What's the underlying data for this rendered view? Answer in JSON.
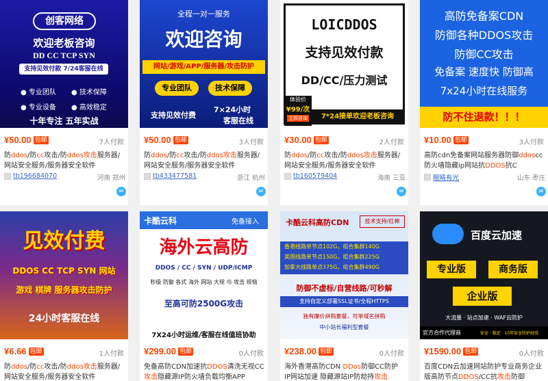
{
  "products": [
    {
      "price": "¥50.00",
      "badge": "包邮",
      "sales": "7人付款",
      "title_parts": [
        "防",
        "ddos",
        "/防",
        "cc",
        "攻击/防",
        "ddos攻击",
        "服务器/网站安全服务/服务器安全软件"
      ],
      "shop": "tb196684070",
      "location": "河南 郑州",
      "thumb": {
        "brand": "创客网络",
        "line1": "欢迎老板咨询",
        "line2": "DD  CC  TCP  SYN",
        "line3": "支持见效付款 7/24客服在线",
        "bullets": [
          "专业团队",
          "技术保障",
          "专业设备",
          "高效稳定"
        ],
        "footer": "十年专注 五年实战"
      }
    },
    {
      "price": "¥50.00",
      "badge": "包邮",
      "sales": "3人付款",
      "title_parts": [
        "防",
        "ddos",
        "/防",
        "cc",
        "攻击/防",
        "ddos攻击",
        "服务器/网站安全服务/服务器安全软件"
      ],
      "shop": "tb433477581",
      "location": "浙江 杭州",
      "thumb": {
        "top": "全程一对一服务",
        "big": "欢迎咨询",
        "bar": "网站/游戏/APP/服务器/攻击防护",
        "btn1": "专业团队",
        "btn2": "技术保障",
        "left": "支持见效付费",
        "right1": "7×24小时",
        "right2": "客服在线"
      }
    },
    {
      "price": "¥30.00",
      "badge": "包邮",
      "sales": "2人付款",
      "title_parts": [
        "防",
        "ddos",
        "/防",
        "cc",
        "攻击/防",
        "ddos攻击",
        "服务器/网站安全服务/服务器安全软件"
      ],
      "shop": "tb160579404",
      "location": "海南 三亚",
      "thumb": {
        "brand": "LOICDDOS",
        "line1": "支持见效付款",
        "line2": "DD/CC/压力测试",
        "tag": "体验价",
        "tagprice": "¥99/次",
        "tagsub": "立即咨询",
        "footer": "7*24接单欢迎老板咨询"
      }
    },
    {
      "price": "¥10.00",
      "badge": "包邮",
      "sales": "3人付款",
      "title_parts": [
        "高防cdn免备案网站服务器防御",
        "ddos",
        "cc防火墙隐藏ip网站抗",
        "DDOS",
        "抗C"
      ],
      "shop": "眼睛有光",
      "location": "山东 枣庄",
      "thumb": {
        "lines": [
          "高防免备案CDN",
          "防御各种DDOS攻击",
          "防御CC攻击",
          "免备案 速度快 防御高",
          "7x24小时在线服务"
        ],
        "footer": "防不住退款！！！"
      }
    },
    {
      "price": "¥6.66",
      "badge": "包邮",
      "sales": "1人付款",
      "title_parts": [
        "防",
        "ddos",
        "/防",
        "cc",
        "攻击/防",
        "ddos攻击",
        "服务器/网站安全服务/服务器安全软件"
      ],
      "thumb": {
        "big": "见效付费",
        "line1": "DDOS CC TCP SYN 网站",
        "line2": "游戏 棋牌 服务器攻击防护",
        "footer": "24小时客服在线"
      }
    },
    {
      "price": "¥299.00",
      "badge": "包邮",
      "sales": "0人付款",
      "title_parts": [
        "免备高防CDN加速抗",
        "DDOS",
        "清洗无视CC",
        "攻击",
        "隐藏源IP防火墙负载均衡APP"
      ],
      "thumb": {
        "brand": "卡酷云科",
        "tag": "免备接入",
        "big": "海外云高防",
        "line1": "DDOS / CC / SYN / UDP/ICMP",
        "line2": "秒级 防御 各式 海外 网站 大规 与 攻击 烦恼",
        "line3": "至高可防2500G攻击",
        "footer": "7X24小时运维/客服在线值班协助"
      }
    },
    {
      "price": "¥238.00",
      "badge": "包邮",
      "sales": "0人付款",
      "title_parts": [
        "海外香港高防CDN ",
        "DDos",
        "防御CC防护 IP网站加速 隐藏源站IP防劫持",
        "攻击"
      ],
      "thumb": {
        "brand": "卡酷云科高防CDN",
        "tag": "技术支持/红棉",
        "rows": [
          "香港线路单节点102G，组合集群140G",
          "美国线路单节点150G，组合集群225G",
          "加拿大线路单点375G，组合集群490G"
        ],
        "mid": "防御不虚标/自营线路/可秒解",
        "line1": "支持自定义部署SSL证书/全程HTTPS",
        "line2": "独有廉价拼购套餐，可单域名拼购",
        "line3": "中小站长福利型套餐"
      }
    },
    {
      "price": "¥1590.00",
      "badge": "包邮",
      "sales": "0人付款",
      "title_parts": [
        "百度CDN云加速网站防护专业商务企业版高防节点",
        "DDOS",
        "/CC抗",
        "攻击",
        "防御"
      ],
      "thumb": {
        "brand": "百度云加速",
        "pro": "专业版",
        "biz": "商务版",
        "ent": "企业版",
        "line1": "大流量 · 站点加速 · WAF云防护",
        "footer": "官方合作代理商",
        "footer2": "安全 · 稳定 · 10年安全防护经验"
      }
    }
  ],
  "colors": {
    "price": "#ff4400",
    "link": "#3366cc",
    "muted": "#888888"
  }
}
